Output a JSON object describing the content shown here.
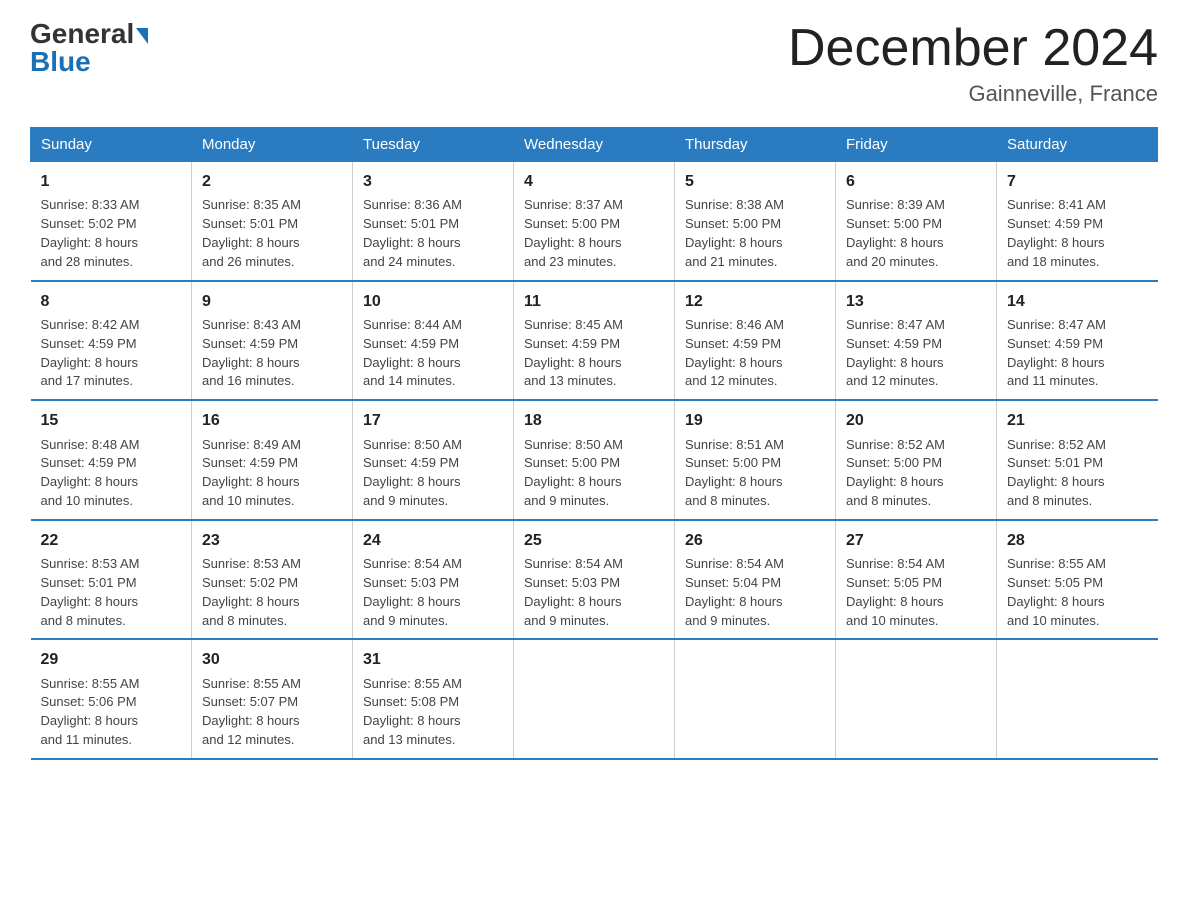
{
  "header": {
    "logo_general": "General",
    "logo_blue": "Blue",
    "main_title": "December 2024",
    "subtitle": "Gainneville, France"
  },
  "days_header": [
    "Sunday",
    "Monday",
    "Tuesday",
    "Wednesday",
    "Thursday",
    "Friday",
    "Saturday"
  ],
  "weeks": [
    [
      {
        "day": "1",
        "lines": [
          "Sunrise: 8:33 AM",
          "Sunset: 5:02 PM",
          "Daylight: 8 hours",
          "and 28 minutes."
        ]
      },
      {
        "day": "2",
        "lines": [
          "Sunrise: 8:35 AM",
          "Sunset: 5:01 PM",
          "Daylight: 8 hours",
          "and 26 minutes."
        ]
      },
      {
        "day": "3",
        "lines": [
          "Sunrise: 8:36 AM",
          "Sunset: 5:01 PM",
          "Daylight: 8 hours",
          "and 24 minutes."
        ]
      },
      {
        "day": "4",
        "lines": [
          "Sunrise: 8:37 AM",
          "Sunset: 5:00 PM",
          "Daylight: 8 hours",
          "and 23 minutes."
        ]
      },
      {
        "day": "5",
        "lines": [
          "Sunrise: 8:38 AM",
          "Sunset: 5:00 PM",
          "Daylight: 8 hours",
          "and 21 minutes."
        ]
      },
      {
        "day": "6",
        "lines": [
          "Sunrise: 8:39 AM",
          "Sunset: 5:00 PM",
          "Daylight: 8 hours",
          "and 20 minutes."
        ]
      },
      {
        "day": "7",
        "lines": [
          "Sunrise: 8:41 AM",
          "Sunset: 4:59 PM",
          "Daylight: 8 hours",
          "and 18 minutes."
        ]
      }
    ],
    [
      {
        "day": "8",
        "lines": [
          "Sunrise: 8:42 AM",
          "Sunset: 4:59 PM",
          "Daylight: 8 hours",
          "and 17 minutes."
        ]
      },
      {
        "day": "9",
        "lines": [
          "Sunrise: 8:43 AM",
          "Sunset: 4:59 PM",
          "Daylight: 8 hours",
          "and 16 minutes."
        ]
      },
      {
        "day": "10",
        "lines": [
          "Sunrise: 8:44 AM",
          "Sunset: 4:59 PM",
          "Daylight: 8 hours",
          "and 14 minutes."
        ]
      },
      {
        "day": "11",
        "lines": [
          "Sunrise: 8:45 AM",
          "Sunset: 4:59 PM",
          "Daylight: 8 hours",
          "and 13 minutes."
        ]
      },
      {
        "day": "12",
        "lines": [
          "Sunrise: 8:46 AM",
          "Sunset: 4:59 PM",
          "Daylight: 8 hours",
          "and 12 minutes."
        ]
      },
      {
        "day": "13",
        "lines": [
          "Sunrise: 8:47 AM",
          "Sunset: 4:59 PM",
          "Daylight: 8 hours",
          "and 12 minutes."
        ]
      },
      {
        "day": "14",
        "lines": [
          "Sunrise: 8:47 AM",
          "Sunset: 4:59 PM",
          "Daylight: 8 hours",
          "and 11 minutes."
        ]
      }
    ],
    [
      {
        "day": "15",
        "lines": [
          "Sunrise: 8:48 AM",
          "Sunset: 4:59 PM",
          "Daylight: 8 hours",
          "and 10 minutes."
        ]
      },
      {
        "day": "16",
        "lines": [
          "Sunrise: 8:49 AM",
          "Sunset: 4:59 PM",
          "Daylight: 8 hours",
          "and 10 minutes."
        ]
      },
      {
        "day": "17",
        "lines": [
          "Sunrise: 8:50 AM",
          "Sunset: 4:59 PM",
          "Daylight: 8 hours",
          "and 9 minutes."
        ]
      },
      {
        "day": "18",
        "lines": [
          "Sunrise: 8:50 AM",
          "Sunset: 5:00 PM",
          "Daylight: 8 hours",
          "and 9 minutes."
        ]
      },
      {
        "day": "19",
        "lines": [
          "Sunrise: 8:51 AM",
          "Sunset: 5:00 PM",
          "Daylight: 8 hours",
          "and 8 minutes."
        ]
      },
      {
        "day": "20",
        "lines": [
          "Sunrise: 8:52 AM",
          "Sunset: 5:00 PM",
          "Daylight: 8 hours",
          "and 8 minutes."
        ]
      },
      {
        "day": "21",
        "lines": [
          "Sunrise: 8:52 AM",
          "Sunset: 5:01 PM",
          "Daylight: 8 hours",
          "and 8 minutes."
        ]
      }
    ],
    [
      {
        "day": "22",
        "lines": [
          "Sunrise: 8:53 AM",
          "Sunset: 5:01 PM",
          "Daylight: 8 hours",
          "and 8 minutes."
        ]
      },
      {
        "day": "23",
        "lines": [
          "Sunrise: 8:53 AM",
          "Sunset: 5:02 PM",
          "Daylight: 8 hours",
          "and 8 minutes."
        ]
      },
      {
        "day": "24",
        "lines": [
          "Sunrise: 8:54 AM",
          "Sunset: 5:03 PM",
          "Daylight: 8 hours",
          "and 9 minutes."
        ]
      },
      {
        "day": "25",
        "lines": [
          "Sunrise: 8:54 AM",
          "Sunset: 5:03 PM",
          "Daylight: 8 hours",
          "and 9 minutes."
        ]
      },
      {
        "day": "26",
        "lines": [
          "Sunrise: 8:54 AM",
          "Sunset: 5:04 PM",
          "Daylight: 8 hours",
          "and 9 minutes."
        ]
      },
      {
        "day": "27",
        "lines": [
          "Sunrise: 8:54 AM",
          "Sunset: 5:05 PM",
          "Daylight: 8 hours",
          "and 10 minutes."
        ]
      },
      {
        "day": "28",
        "lines": [
          "Sunrise: 8:55 AM",
          "Sunset: 5:05 PM",
          "Daylight: 8 hours",
          "and 10 minutes."
        ]
      }
    ],
    [
      {
        "day": "29",
        "lines": [
          "Sunrise: 8:55 AM",
          "Sunset: 5:06 PM",
          "Daylight: 8 hours",
          "and 11 minutes."
        ]
      },
      {
        "day": "30",
        "lines": [
          "Sunrise: 8:55 AM",
          "Sunset: 5:07 PM",
          "Daylight: 8 hours",
          "and 12 minutes."
        ]
      },
      {
        "day": "31",
        "lines": [
          "Sunrise: 8:55 AM",
          "Sunset: 5:08 PM",
          "Daylight: 8 hours",
          "and 13 minutes."
        ]
      },
      {
        "day": "",
        "lines": []
      },
      {
        "day": "",
        "lines": []
      },
      {
        "day": "",
        "lines": []
      },
      {
        "day": "",
        "lines": []
      }
    ]
  ]
}
